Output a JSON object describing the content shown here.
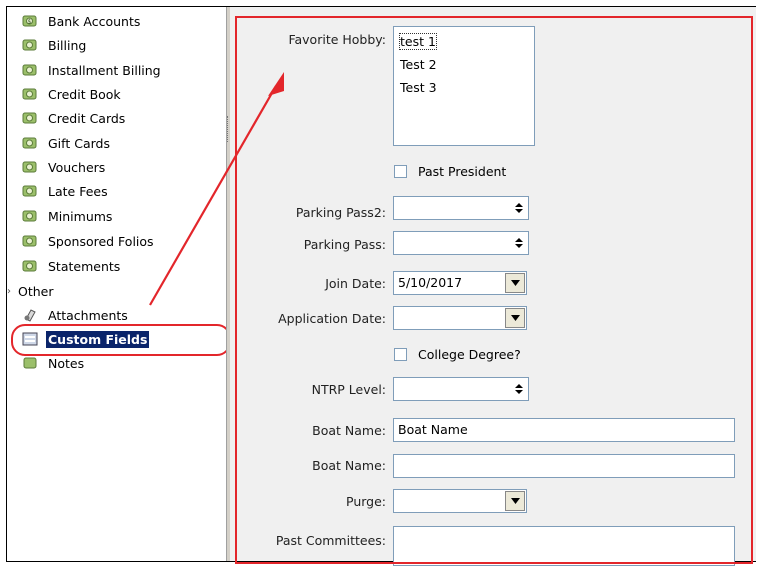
{
  "sidebar": {
    "items": [
      {
        "label": "Bank Accounts",
        "icon": "money-icon"
      },
      {
        "label": "Billing",
        "icon": "money-icon"
      },
      {
        "label": "Installment Billing",
        "icon": "money-icon"
      },
      {
        "label": "Credit Book",
        "icon": "money-icon"
      },
      {
        "label": "Credit Cards",
        "icon": "money-icon"
      },
      {
        "label": "Gift Cards",
        "icon": "money-icon"
      },
      {
        "label": "Vouchers",
        "icon": "money-icon"
      },
      {
        "label": "Late Fees",
        "icon": "money-icon"
      },
      {
        "label": "Minimums",
        "icon": "money-icon"
      },
      {
        "label": "Sponsored Folios",
        "icon": "money-icon"
      },
      {
        "label": "Statements",
        "icon": "money-icon"
      }
    ],
    "group": {
      "label": "Other",
      "expander": "›"
    },
    "sub_items": [
      {
        "label": "Attachments",
        "icon": "attachment-icon"
      },
      {
        "label": "Custom Fields",
        "icon": "custom-fields-icon",
        "selected": true
      },
      {
        "label": "Notes",
        "icon": "notes-icon"
      }
    ]
  },
  "form": {
    "favorite_hobby": {
      "label": "Favorite Hobby:",
      "options": [
        "test 1",
        "Test 2",
        "Test 3"
      ]
    },
    "past_president": {
      "label": "Past President",
      "checked": false
    },
    "parking_pass2": {
      "label": "Parking Pass2:",
      "value": ""
    },
    "parking_pass": {
      "label": "Parking Pass:",
      "value": ""
    },
    "join_date": {
      "label": "Join Date:",
      "value": "5/10/2017"
    },
    "application_date": {
      "label": "Application Date:",
      "value": ""
    },
    "college_degree": {
      "label": "College Degree?",
      "checked": false
    },
    "ntrp_level": {
      "label": "NTRP Level:",
      "value": ""
    },
    "boat_name_1": {
      "label": "Boat Name:",
      "value": "Boat Name"
    },
    "boat_name_2": {
      "label": "Boat Name:",
      "value": ""
    },
    "purge": {
      "label": "Purge:",
      "value": ""
    },
    "past_committees": {
      "label": "Past Committees:",
      "value": ""
    }
  },
  "colors": {
    "annotation": "#e3262b",
    "selection": "#0a246a",
    "panel": "#f0f0f0"
  }
}
